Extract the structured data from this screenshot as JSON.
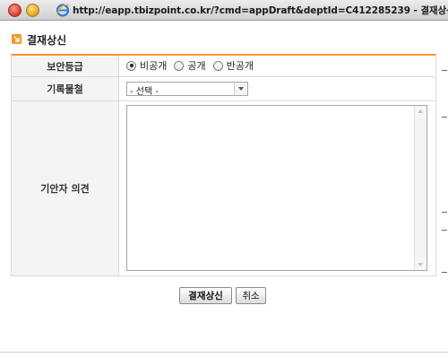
{
  "window": {
    "title": "http://eapp.tbizpoint.co.kr/?cmd=appDraft&deptId=C412285239 - 결재상신 ..."
  },
  "heading": {
    "icon": "arrow-down-right-icon",
    "title": "결재상신"
  },
  "form": {
    "security": {
      "label": "보안등급",
      "options": [
        {
          "label": "비공개",
          "checked": true
        },
        {
          "label": "공개",
          "checked": false
        },
        {
          "label": "반공개",
          "checked": false
        }
      ]
    },
    "record": {
      "label": "기록물철",
      "selected": "- 선택 -"
    },
    "opinion": {
      "label": "기안자 의견",
      "value": ""
    }
  },
  "buttons": {
    "submit": "결재상신",
    "cancel": "취소"
  },
  "colors": {
    "accent": "#f39a2a",
    "label_bg": "#f4f4f4",
    "border": "#d9d9d9"
  }
}
